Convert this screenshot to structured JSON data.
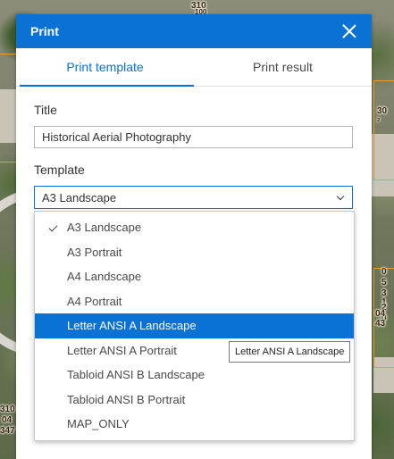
{
  "map": {
    "parcel_labels": [
      "310",
      "100",
      "30",
      "²",
      "0",
      "5",
      "3",
      "1",
      "2",
      "0",
      "04",
      "43",
      "310",
      "04",
      "347"
    ]
  },
  "panel": {
    "title": "Print",
    "tabs": [
      {
        "label": "Print template",
        "active": true
      },
      {
        "label": "Print result",
        "active": false
      }
    ],
    "title_field": {
      "label": "Title",
      "value": "Historical Aerial Photography"
    },
    "template_field": {
      "label": "Template",
      "selected": "A3 Landscape"
    },
    "template_options": [
      {
        "label": "A3 Landscape",
        "checked": true
      },
      {
        "label": "A3 Portrait"
      },
      {
        "label": "A4 Landscape"
      },
      {
        "label": "A4 Portrait"
      },
      {
        "label": "Letter ANSI A Landscape",
        "highlighted": true
      },
      {
        "label": "Letter ANSI A Portrait"
      },
      {
        "label": "Tabloid ANSI B Landscape"
      },
      {
        "label": "Tabloid ANSI B Portrait"
      },
      {
        "label": "MAP_ONLY"
      }
    ],
    "tooltip": "Letter ANSI A Landscape"
  },
  "colors": {
    "accent": "#0a72d4",
    "header_text": "#ffffff",
    "parcel_line": "#e5a12b"
  }
}
